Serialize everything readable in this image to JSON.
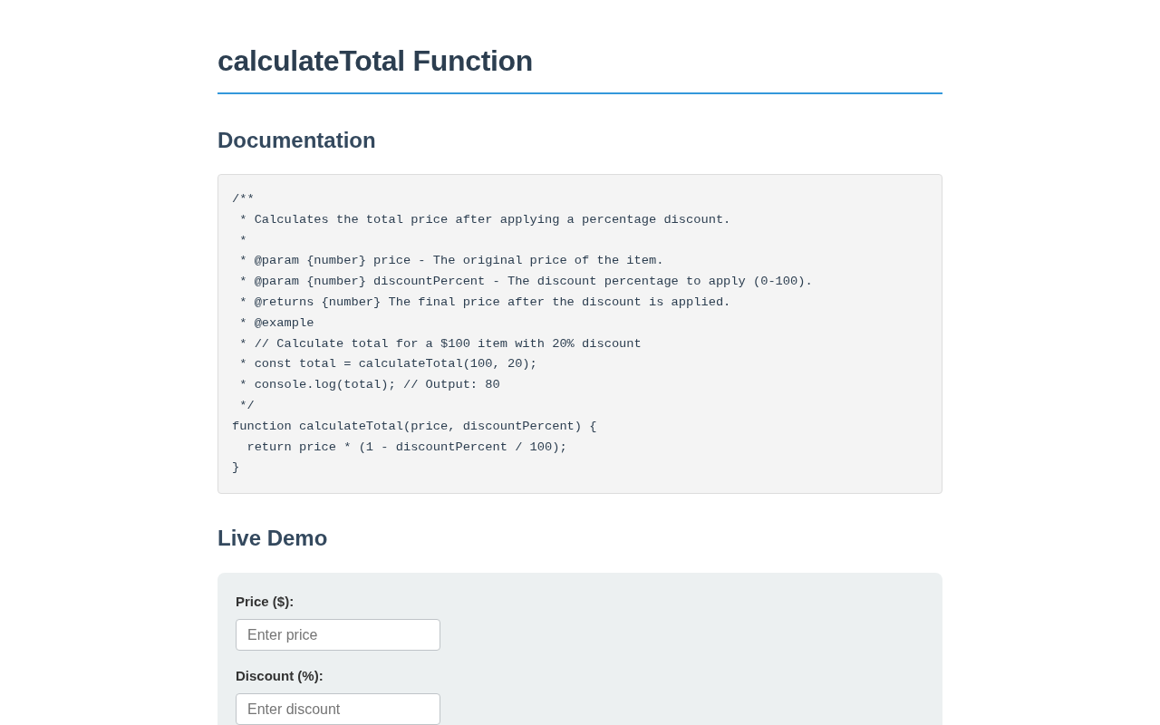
{
  "page": {
    "title": "calculateTotal Function"
  },
  "documentation": {
    "heading": "Documentation",
    "code": "/**\n * Calculates the total price after applying a percentage discount.\n *\n * @param {number} price - The original price of the item.\n * @param {number} discountPercent - The discount percentage to apply (0-100).\n * @returns {number} The final price after the discount is applied.\n * @example\n * // Calculate total for a $100 item with 20% discount\n * const total = calculateTotal(100, 20);\n * console.log(total); // Output: 80\n */\nfunction calculateTotal(price, discountPercent) {\n  return price * (1 - discountPercent / 100);\n}"
  },
  "live_demo": {
    "heading": "Live Demo",
    "fields": [
      {
        "label": "Price ($):",
        "placeholder": "Enter price"
      },
      {
        "label": "Discount (%):",
        "placeholder": "Enter discount"
      }
    ]
  }
}
